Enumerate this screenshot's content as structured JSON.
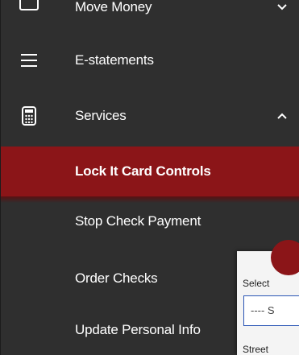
{
  "menu": {
    "items": [
      {
        "key": "move",
        "label": "Move Money",
        "icon": "transfer-icon",
        "chevron": "chevron-down-icon"
      },
      {
        "key": "estatements",
        "label": "E-statements",
        "icon": "menu-lines-icon"
      },
      {
        "key": "services",
        "label": "Services",
        "icon": "calculator-icon",
        "chevron": "chevron-up-icon"
      },
      {
        "key": "lock",
        "label": "Lock It Card Controls",
        "active": true
      },
      {
        "key": "stop",
        "label": "Stop Check Payment"
      },
      {
        "key": "order",
        "label": "Order Checks"
      },
      {
        "key": "update",
        "label": "Update Personal Info"
      }
    ]
  },
  "form": {
    "select_label": "Select",
    "select_value": "---- S",
    "street_label": "Street"
  },
  "colors": {
    "menu_bg": "#2f2f2f",
    "active_bg": "#8b1518",
    "text": "#ffffff",
    "select_border": "#2a55b5"
  }
}
